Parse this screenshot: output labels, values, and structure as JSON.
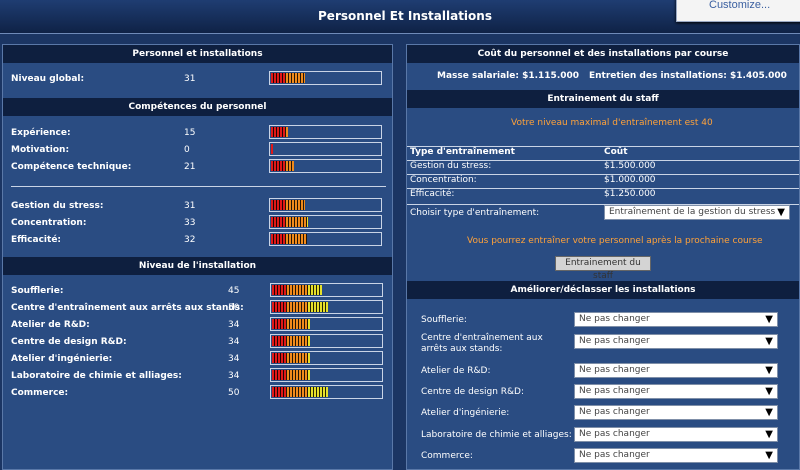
{
  "title": "Personnel Et Installations",
  "popup": {
    "label": "Customize..."
  },
  "left": {
    "header1": "Personnel et installations",
    "overall": {
      "label": "Niveau global:",
      "value": 31
    },
    "header2": "Compétences du personnel",
    "skills": [
      {
        "label": "Expérience:",
        "value": 15
      },
      {
        "label": "Motivation:",
        "value": 0
      },
      {
        "label": "Compétence technique:",
        "value": 21
      }
    ],
    "skills2": [
      {
        "label": "Gestion du stress:",
        "value": 31
      },
      {
        "label": "Concentration:",
        "value": 33
      },
      {
        "label": "Efficacité:",
        "value": 32
      }
    ],
    "header3": "Niveau de l'installation",
    "facilities": [
      {
        "label": "Soufflerie:",
        "value": 45
      },
      {
        "label": "Centre d'entraînement aux arrêts aux stands:",
        "value": 50
      },
      {
        "label": "Atelier de R&D:",
        "value": 34
      },
      {
        "label": "Centre de design R&D:",
        "value": 34
      },
      {
        "label": "Atelier d'ingénierie:",
        "value": 34
      },
      {
        "label": "Laboratoire de chimie et alliages:",
        "value": 34
      },
      {
        "label": "Commerce:",
        "value": 50
      }
    ]
  },
  "right": {
    "header1": "Coût du personnel et des installations par course",
    "salary": "Masse salariale: $1.115.000",
    "maintenance": "Entretien des installations: $1.405.000",
    "header2": "Entrainement du staff",
    "max_level_msg": "Votre niveau maximal d'entraînement est 40",
    "table_headers": {
      "type": "Type d'entraînement",
      "cost": "Coût"
    },
    "trainings": [
      {
        "type": "Gestion du stress:",
        "cost": "$1.500.000"
      },
      {
        "type": "Concentration:",
        "cost": "$1.000.000"
      },
      {
        "type": "Efficacité:",
        "cost": "$1.250.000"
      }
    ],
    "choose_label": "Choisir type d'entraînement:",
    "choose_value": "Entraînement de la gestion du stress",
    "next_race_msg": "Vous pourrez entraîner votre personnel après la prochaine course",
    "train_button": "Entrainement du staff",
    "header3": "Améliorer/déclasser les installations",
    "upgrades": [
      {
        "label": "Soufflerie:",
        "value": "Ne pas changer"
      },
      {
        "label": "Centre d'entraînement aux arrêts aux stands:",
        "value": "Ne pas changer"
      },
      {
        "label": "Atelier de R&D:",
        "value": "Ne pas changer"
      },
      {
        "label": "Centre de design R&D:",
        "value": "Ne pas changer"
      },
      {
        "label": "Atelier d'ingénierie:",
        "value": "Ne pas changer"
      },
      {
        "label": "Laboratoire de chimie et alliages:",
        "value": "Ne pas changer"
      },
      {
        "label": "Commerce:",
        "value": "Ne pas changer"
      }
    ]
  },
  "colors": {
    "low": "#e01818",
    "mid": "#f08a1c",
    "high": "#e6e02a"
  }
}
